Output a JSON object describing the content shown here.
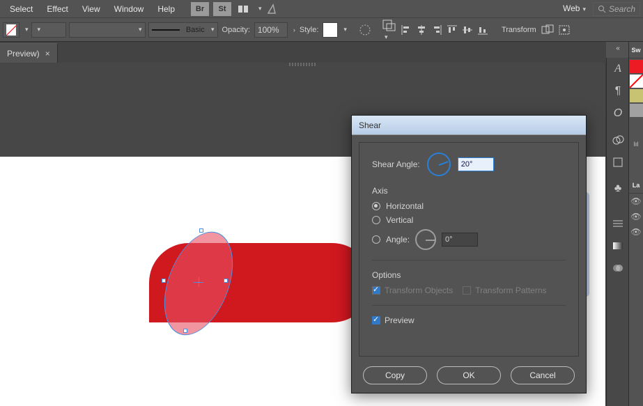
{
  "menu": {
    "select": "Select",
    "effect": "Effect",
    "view": "View",
    "window": "Window",
    "help": "Help",
    "br": "Br",
    "st": "St"
  },
  "topright": {
    "workspace": "Web",
    "search_placeholder": "Search"
  },
  "toolbar": {
    "stroke_preset": "Basic",
    "opacity_label": "Opacity:",
    "opacity_value": "100%",
    "style_label": "Style:",
    "transform_label": "Transform"
  },
  "tab": {
    "name": "Preview)",
    "close": "×"
  },
  "dock_panels": {
    "p1": "Sw",
    "p2": "La"
  },
  "dialog": {
    "title": "Shear",
    "shear_angle_label": "Shear Angle:",
    "shear_angle_value": "20°",
    "axis_label": "Axis",
    "axis_horizontal": "Horizontal",
    "axis_vertical": "Vertical",
    "axis_angle_label": "Angle:",
    "axis_angle_value": "0°",
    "options_label": "Options",
    "transform_objects": "Transform Objects",
    "transform_patterns": "Transform Patterns",
    "preview": "Preview",
    "copy": "Copy",
    "ok": "OK",
    "cancel": "Cancel"
  }
}
